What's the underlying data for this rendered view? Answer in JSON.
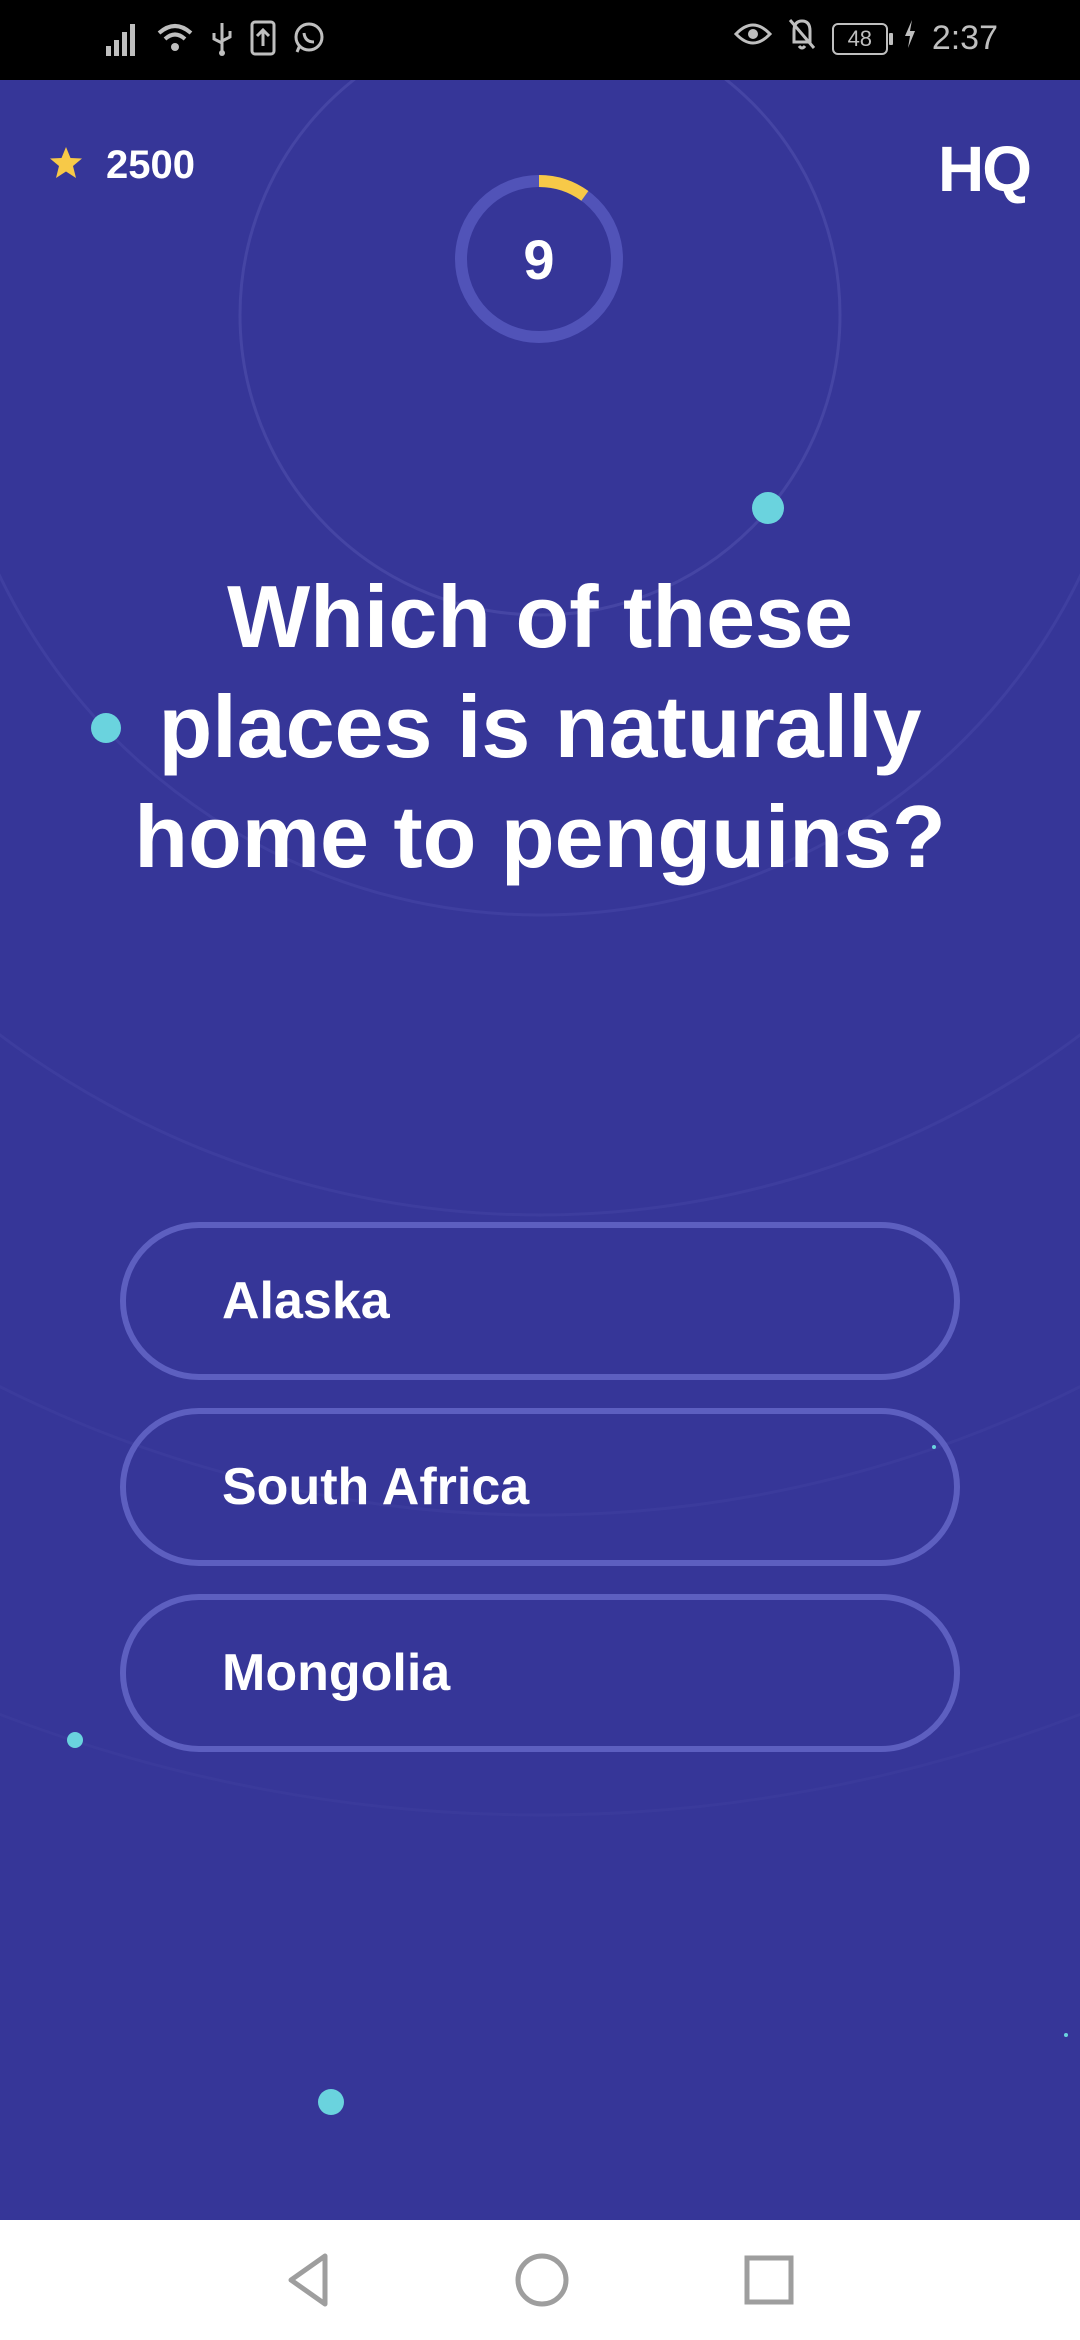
{
  "status_bar": {
    "time": "2:37",
    "battery": "48",
    "icons": [
      "signal-icon",
      "wifi-icon",
      "usb-icon",
      "upload-icon",
      "whatsapp-icon",
      "eye-icon",
      "bell-off-icon",
      "battery-icon",
      "charging-icon"
    ]
  },
  "header": {
    "score": "2500",
    "logo": "HQ"
  },
  "timer": {
    "seconds_left": "9",
    "progress_fraction": 0.1
  },
  "question": {
    "text": "Which of these places is naturally home to penguins?"
  },
  "answers": [
    {
      "label": "Alaska"
    },
    {
      "label": "South Africa"
    },
    {
      "label": "Mongolia"
    }
  ],
  "nav_bar": {
    "buttons": [
      "back-icon",
      "home-icon",
      "recents-icon"
    ]
  },
  "colors": {
    "background": "#363698",
    "accent_yellow": "#f7c948",
    "dot_teal": "#6ad3de",
    "answer_border": "#5d5fc0"
  }
}
